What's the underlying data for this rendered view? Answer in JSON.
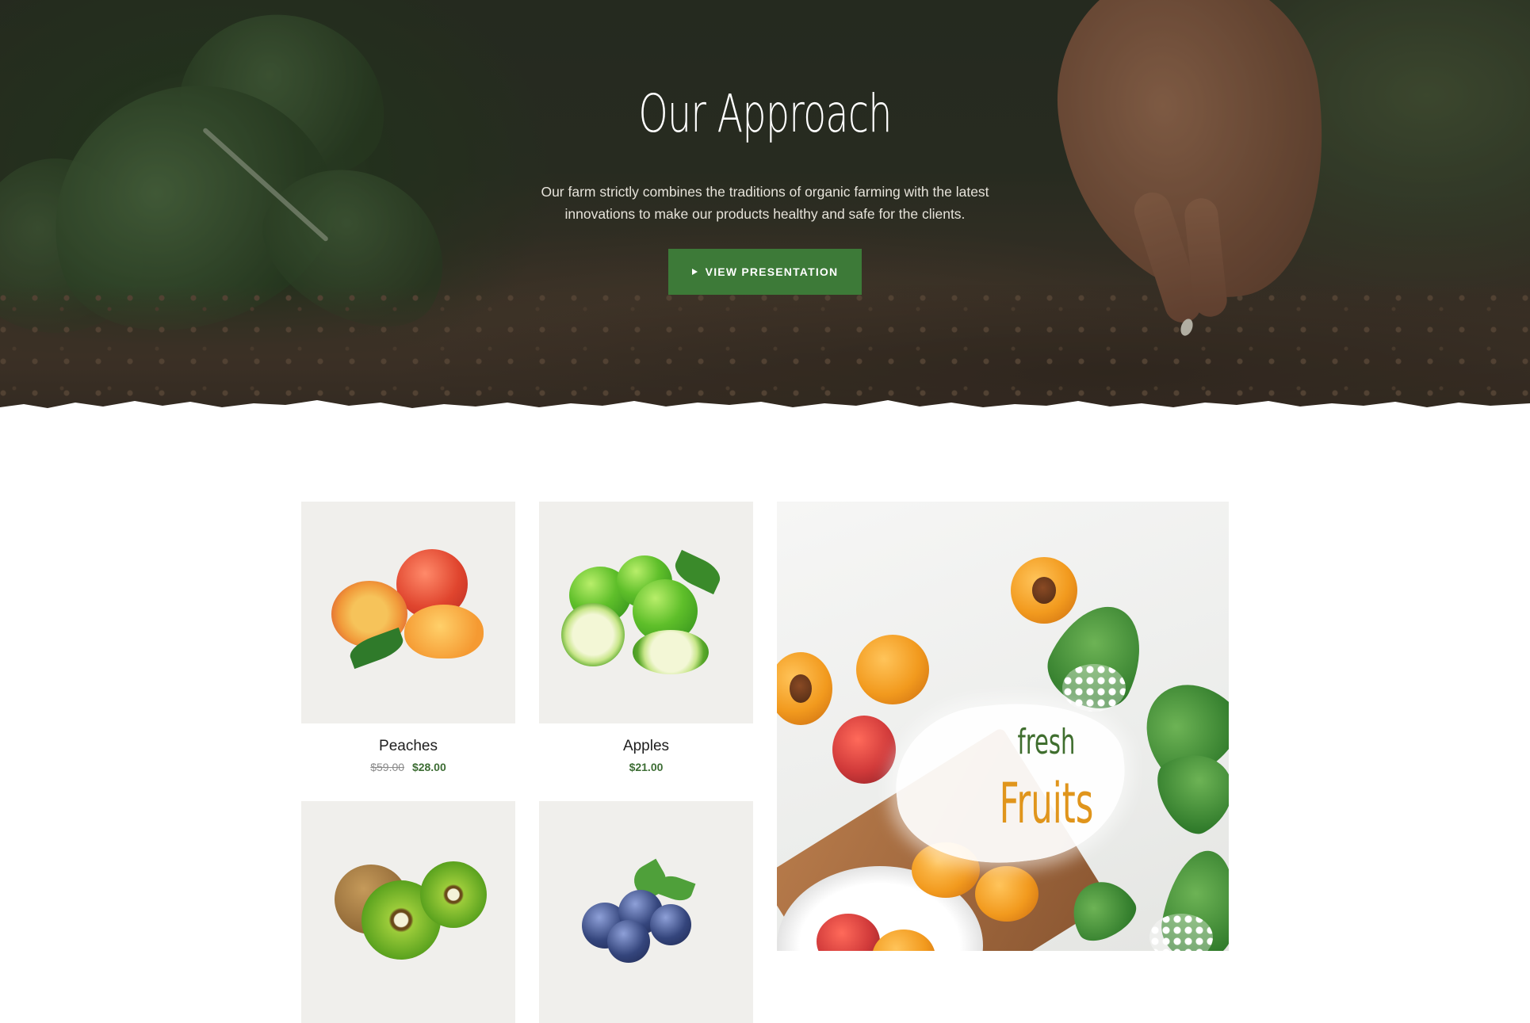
{
  "hero": {
    "title": "Our Approach",
    "description": "Our farm strictly combines the traditions of organic farming with the latest innovations to make our products healthy and safe for the clients.",
    "button_label": "VIEW PRESENTATION",
    "button_icon": "play-icon"
  },
  "products": [
    {
      "name": "Peaches",
      "old_price": "$59.00",
      "price": "$28.00"
    },
    {
      "name": "Apples",
      "price": "$21.00"
    },
    {
      "name": "",
      "price": ""
    },
    {
      "name": "",
      "price": ""
    }
  ],
  "feature": {
    "line1": "fresh",
    "line2": "Fruits"
  },
  "colors": {
    "accent_green": "#3d7a38",
    "price_green": "#3d6d34",
    "feature_orange": "#e0951c"
  }
}
